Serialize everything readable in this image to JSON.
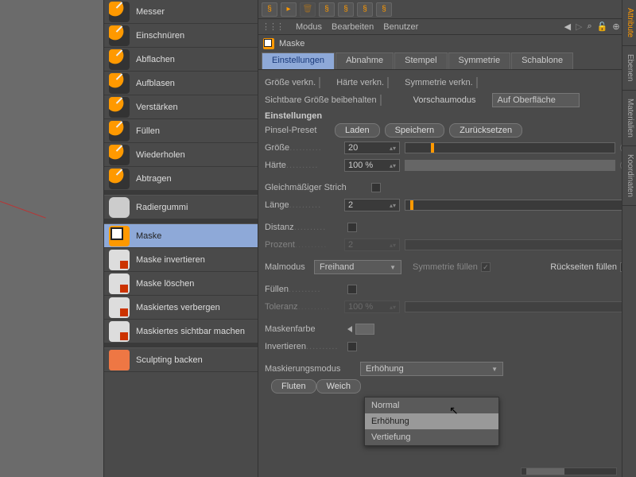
{
  "tools": {
    "items": [
      {
        "label": "Messer",
        "k": "brush"
      },
      {
        "label": "Einschnüren",
        "k": "brush"
      },
      {
        "label": "Abflachen",
        "k": "brush"
      },
      {
        "label": "Aufblasen",
        "k": "brush"
      },
      {
        "label": "Verstärken",
        "k": "brush"
      },
      {
        "label": "Füllen",
        "k": "brush"
      },
      {
        "label": "Wiederholen",
        "k": "brush"
      },
      {
        "label": "Abtragen",
        "k": "brush"
      }
    ],
    "eraser": "Radiergummi",
    "mask_items": [
      {
        "label": "Maske",
        "sel": true,
        "k": "mask"
      },
      {
        "label": "Maske invertieren",
        "k": "maskop"
      },
      {
        "label": "Maske löschen",
        "k": "maskop"
      },
      {
        "label": "Maskiertes verbergen",
        "k": "maskop"
      },
      {
        "label": "Maskiertes sichtbar machen",
        "k": "maskop"
      }
    ],
    "bake": "Sculpting backen"
  },
  "menus": {
    "modus": "Modus",
    "bearbeiten": "Bearbeiten",
    "benutzer": "Benutzer"
  },
  "title": "Maske",
  "tabs": [
    "Einstellungen",
    "Abnahme",
    "Stempel",
    "Symmetrie",
    "Schablone"
  ],
  "labels": {
    "groesse_verkn": "Größe verkn.",
    "haerte_verkn": "Härte verkn.",
    "symmetrie_verkn": "Symmetrie verkn.",
    "sichtbare": "Sichtbare Größe beibehalten",
    "vorschau": "Vorschaumodus",
    "vorschau_val": "Auf Oberfläche",
    "einstellungen": "Einstellungen",
    "preset": "Pinsel-Preset",
    "laden": "Laden",
    "speichern": "Speichern",
    "zurueck": "Zurücksetzen",
    "groesse": "Größe",
    "haerte": "Härte",
    "gleichm": "Gleichmäßiger Strich",
    "laenge": "Länge",
    "distanz": "Distanz",
    "prozent": "Prozent",
    "malmodus": "Malmodus",
    "malmodus_val": "Freihand",
    "sym_fuellen": "Symmetrie füllen",
    "rueck_fuellen": "Rückseiten füllen",
    "fuellen": "Füllen",
    "toleranz": "Toleranz",
    "maskenfarbe": "Maskenfarbe",
    "invertieren": "Invertieren",
    "maskmodus": "Maskierungsmodus",
    "maskmodus_val": "Erhöhung",
    "fluten": "Fluten",
    "weich": "Weich"
  },
  "values": {
    "groesse": "20",
    "haerte": "100 %",
    "laenge": "2",
    "prozent": "2",
    "toleranz": "100 %"
  },
  "dropdown": {
    "items": [
      "Normal",
      "Erhöhung",
      "Vertiefung"
    ],
    "hover": 1
  },
  "vtabs": [
    "Attribute",
    "Ebenen",
    "Materialien",
    "Koordinaten"
  ]
}
